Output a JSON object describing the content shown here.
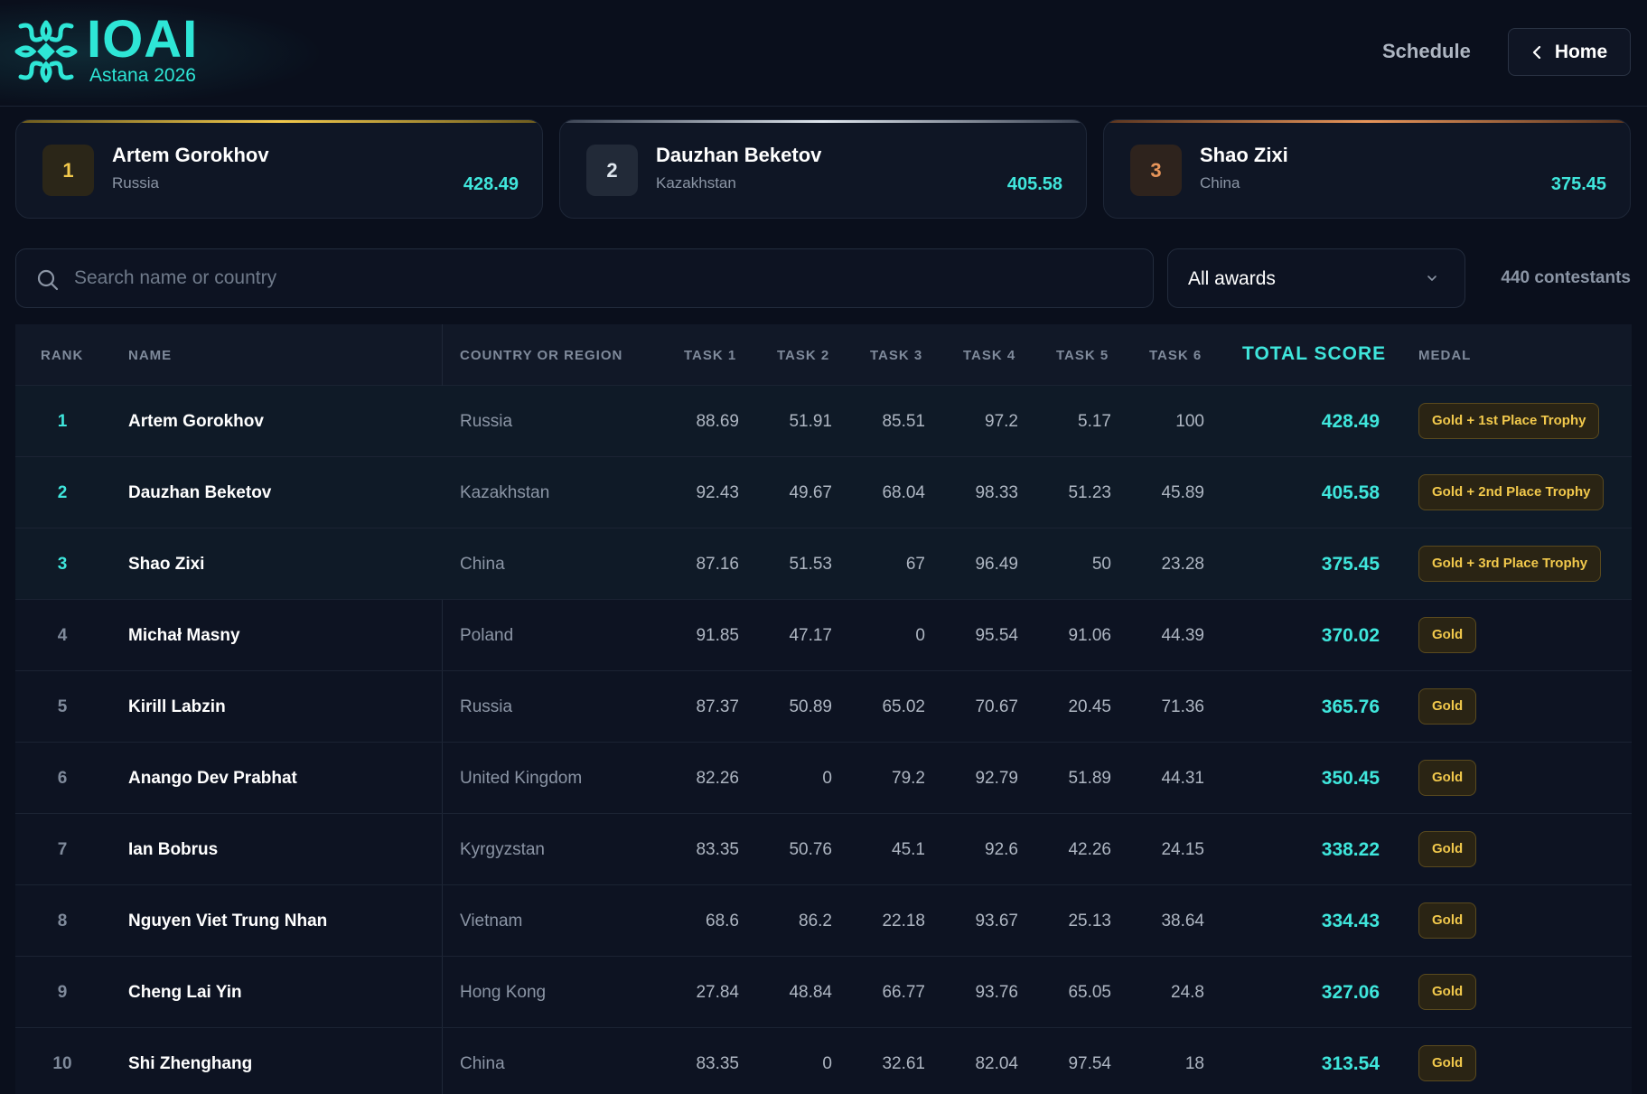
{
  "header": {
    "logo_text": "IOAI",
    "logo_subtitle": "Astana 2026",
    "nav_schedule": "Schedule",
    "home_button": "Home"
  },
  "podium": [
    {
      "rank": "1",
      "name": "Artem Gorokhov",
      "country": "Russia",
      "score": "428.49"
    },
    {
      "rank": "2",
      "name": "Dauzhan Beketov",
      "country": "Kazakhstan",
      "score": "405.58"
    },
    {
      "rank": "3",
      "name": "Shao Zixi",
      "country": "China",
      "score": "375.45"
    }
  ],
  "filters": {
    "search_placeholder": "Search name or country",
    "awards_selected": "All awards",
    "count_label": "440 contestants"
  },
  "table": {
    "columns": {
      "rank": "RANK",
      "name": "NAME",
      "country": "COUNTRY OR REGION",
      "task1": "TASK 1",
      "task2": "TASK 2",
      "task3": "TASK 3",
      "task4": "TASK 4",
      "task5": "TASK 5",
      "task6": "TASK 6",
      "total": "TOTAL SCORE",
      "medal": "MEDAL"
    },
    "rows": [
      {
        "rank": "1",
        "name": "Artem Gorokhov",
        "country": "Russia",
        "t1": "88.69",
        "t2": "51.91",
        "t3": "85.51",
        "t4": "97.2",
        "t5": "5.17",
        "t6": "100",
        "total": "428.49",
        "medal": "Gold + 1st Place Trophy"
      },
      {
        "rank": "2",
        "name": "Dauzhan Beketov",
        "country": "Kazakhstan",
        "t1": "92.43",
        "t2": "49.67",
        "t3": "68.04",
        "t4": "98.33",
        "t5": "51.23",
        "t6": "45.89",
        "total": "405.58",
        "medal": "Gold + 2nd Place Trophy"
      },
      {
        "rank": "3",
        "name": "Shao Zixi",
        "country": "China",
        "t1": "87.16",
        "t2": "51.53",
        "t3": "67",
        "t4": "96.49",
        "t5": "50",
        "t6": "23.28",
        "total": "375.45",
        "medal": "Gold + 3rd Place Trophy"
      },
      {
        "rank": "4",
        "name": "Michał Masny",
        "country": "Poland",
        "t1": "91.85",
        "t2": "47.17",
        "t3": "0",
        "t4": "95.54",
        "t5": "91.06",
        "t6": "44.39",
        "total": "370.02",
        "medal": "Gold"
      },
      {
        "rank": "5",
        "name": "Kirill Labzin",
        "country": "Russia",
        "t1": "87.37",
        "t2": "50.89",
        "t3": "65.02",
        "t4": "70.67",
        "t5": "20.45",
        "t6": "71.36",
        "total": "365.76",
        "medal": "Gold"
      },
      {
        "rank": "6",
        "name": "Anango Dev Prabhat",
        "country": "United Kingdom",
        "t1": "82.26",
        "t2": "0",
        "t3": "79.2",
        "t4": "92.79",
        "t5": "51.89",
        "t6": "44.31",
        "total": "350.45",
        "medal": "Gold"
      },
      {
        "rank": "7",
        "name": "Ian Bobrus",
        "country": "Kyrgyzstan",
        "t1": "83.35",
        "t2": "50.76",
        "t3": "45.1",
        "t4": "92.6",
        "t5": "42.26",
        "t6": "24.15",
        "total": "338.22",
        "medal": "Gold"
      },
      {
        "rank": "8",
        "name": "Nguyen Viet Trung Nhan",
        "country": "Vietnam",
        "t1": "68.6",
        "t2": "86.2",
        "t3": "22.18",
        "t4": "93.67",
        "t5": "25.13",
        "t6": "38.64",
        "total": "334.43",
        "medal": "Gold"
      },
      {
        "rank": "9",
        "name": "Cheng Lai Yin",
        "country": "Hong Kong",
        "t1": "27.84",
        "t2": "48.84",
        "t3": "66.77",
        "t4": "93.76",
        "t5": "65.05",
        "t6": "24.8",
        "total": "327.06",
        "medal": "Gold"
      },
      {
        "rank": "10",
        "name": "Shi Zhenghang",
        "country": "China",
        "t1": "83.35",
        "t2": "0",
        "t3": "32.61",
        "t4": "82.04",
        "t5": "97.54",
        "t6": "18",
        "total": "313.54",
        "medal": "Gold"
      }
    ]
  },
  "colors": {
    "accent": "#3fe6dc",
    "gold": "#f2c94c",
    "silver": "#c9d1dc",
    "bronze": "#e8955a",
    "background": "#0a0f1c"
  },
  "icons": {
    "logo": "ornament-logo-icon",
    "home": "chevron-left-icon",
    "search": "search-icon",
    "dropdown": "chevron-down-icon"
  }
}
